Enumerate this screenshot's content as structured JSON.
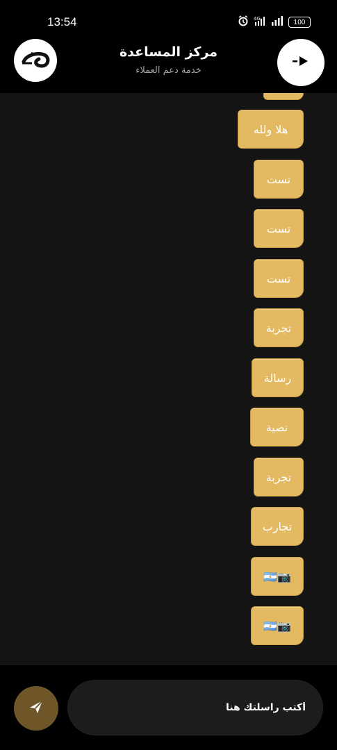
{
  "status_bar": {
    "time": "13:54",
    "battery": "100"
  },
  "header": {
    "title": "مركز المساعدة",
    "subtitle": "خدمة دعم العملاء"
  },
  "messages": [
    "هلا ولله",
    "تست",
    "تست",
    "تست",
    "تجربة",
    "رسالة",
    "نصية",
    "تجربة",
    "تجارب",
    "🇦🇷📷",
    "🇦🇷📷"
  ],
  "input": {
    "placeholder": "أكتب راسلتك هنا"
  },
  "colors": {
    "bubble": "#e3b962",
    "send_button": "#6e5628",
    "chat_background": "#141414",
    "header_background": "#000000"
  }
}
